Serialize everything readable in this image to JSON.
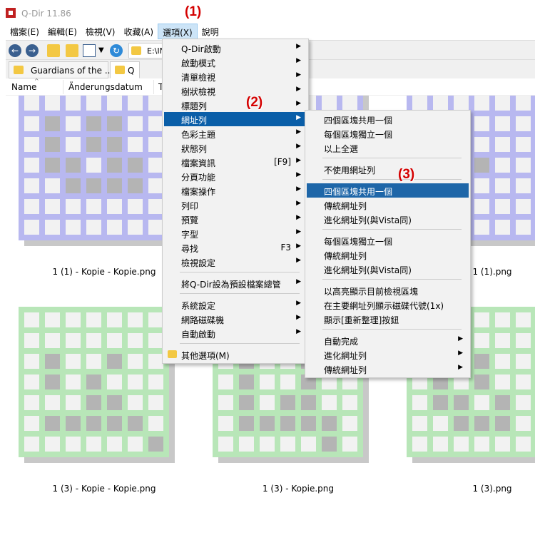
{
  "title": "Q-Dir 11.86",
  "annotations": [
    "(1)",
    "(2)",
    "(3)"
  ],
  "menubar": [
    {
      "label": "檔案(E)",
      "active": false
    },
    {
      "label": "編輯(E)",
      "active": false
    },
    {
      "label": "檢視(V)",
      "active": false
    },
    {
      "label": "收藏(A)",
      "active": false
    },
    {
      "label": "選項(X)",
      "active": true
    },
    {
      "label": "說明",
      "active": false
    }
  ],
  "address": "E:\\INI",
  "tabs": [
    "Guardians of the ...",
    "Q"
  ],
  "columns": [
    "Name",
    "Änderungsdatum",
    "T"
  ],
  "options_menu": [
    {
      "label": "Q-Dir啟動",
      "shortcut": "",
      "submenu": true
    },
    {
      "label": "啟動模式",
      "shortcut": "",
      "submenu": true
    },
    {
      "label": "清單檢視",
      "shortcut": "",
      "submenu": true
    },
    {
      "label": "樹狀檢視",
      "shortcut": "",
      "submenu": true
    },
    {
      "label": "標題列",
      "shortcut": "",
      "submenu": true
    },
    {
      "label": "網址列",
      "shortcut": "",
      "submenu": true,
      "highlight": true
    },
    {
      "label": "色彩主題",
      "shortcut": "",
      "submenu": true
    },
    {
      "label": "狀態列",
      "shortcut": "",
      "submenu": true
    },
    {
      "label": "檔案資訊",
      "shortcut": "[F9]",
      "submenu": true
    },
    {
      "label": "分頁功能",
      "shortcut": "",
      "submenu": true
    },
    {
      "label": "檔案操作",
      "shortcut": "",
      "submenu": true
    },
    {
      "label": "列印",
      "shortcut": "",
      "submenu": true
    },
    {
      "label": "預覽",
      "shortcut": "",
      "submenu": true
    },
    {
      "label": "字型",
      "shortcut": "",
      "submenu": true
    },
    {
      "label": "尋找",
      "shortcut": "F3",
      "submenu": true
    },
    {
      "label": "檢視設定",
      "shortcut": "",
      "submenu": true
    },
    {
      "separator": true
    },
    {
      "label": "將Q-Dir設為預設檔案總管",
      "shortcut": "",
      "submenu": true
    },
    {
      "separator": true
    },
    {
      "label": "系統設定",
      "shortcut": "",
      "submenu": true
    },
    {
      "label": "網路磁碟機",
      "shortcut": "",
      "submenu": true
    },
    {
      "label": "自動啟動",
      "shortcut": "",
      "submenu": true
    },
    {
      "separator": true
    },
    {
      "label": "其他選項(M)",
      "shortcut": "",
      "submenu": false,
      "folder_icon": true
    }
  ],
  "address_submenu": [
    {
      "label": "四個區塊共用一個",
      "submenu": false
    },
    {
      "label": "每個區塊獨立一個",
      "submenu": false
    },
    {
      "label": "以上全選",
      "submenu": false
    },
    {
      "separator": true
    },
    {
      "label": "不使用網址列",
      "submenu": false
    },
    {
      "separator": true
    },
    {
      "label": "四個區塊共用一個",
      "submenu": false,
      "highlight": true
    },
    {
      "label": "傳統網址列",
      "submenu": false
    },
    {
      "label": "進化網址列(與Vista同)",
      "submenu": false
    },
    {
      "separator": true
    },
    {
      "label": "每個區塊獨立一個",
      "submenu": false
    },
    {
      "label": "傳統網址列",
      "submenu": false
    },
    {
      "label": "進化網址列(與Vista同)",
      "submenu": false
    },
    {
      "separator": true
    },
    {
      "label": "以高亮顯示目前檢視區塊",
      "submenu": false
    },
    {
      "label": "在主要網址列顯示磁碟代號(1x)",
      "submenu": false
    },
    {
      "label": "顯示[重新整理]按鈕",
      "submenu": false
    },
    {
      "separator": true
    },
    {
      "label": "自動完成",
      "submenu": true
    },
    {
      "label": "進化網址列",
      "submenu": true
    },
    {
      "label": "傳統網址列",
      "submenu": true
    }
  ],
  "files": [
    {
      "caption": "1 (1) - Kopie - Kopie.png",
      "color": "#b8b8f0"
    },
    {
      "caption": "",
      "color": "#b8b8f0"
    },
    {
      "caption": "1 (1).png",
      "color": "#b8b8f0"
    },
    {
      "caption": "1 (3) - Kopie - Kopie.png",
      "color": "#b8e6b8"
    },
    {
      "caption": "1 (3) - Kopie.png",
      "color": "#b8e6b8"
    },
    {
      "caption": "1 (3).png",
      "color": "#b8e6b8"
    }
  ]
}
